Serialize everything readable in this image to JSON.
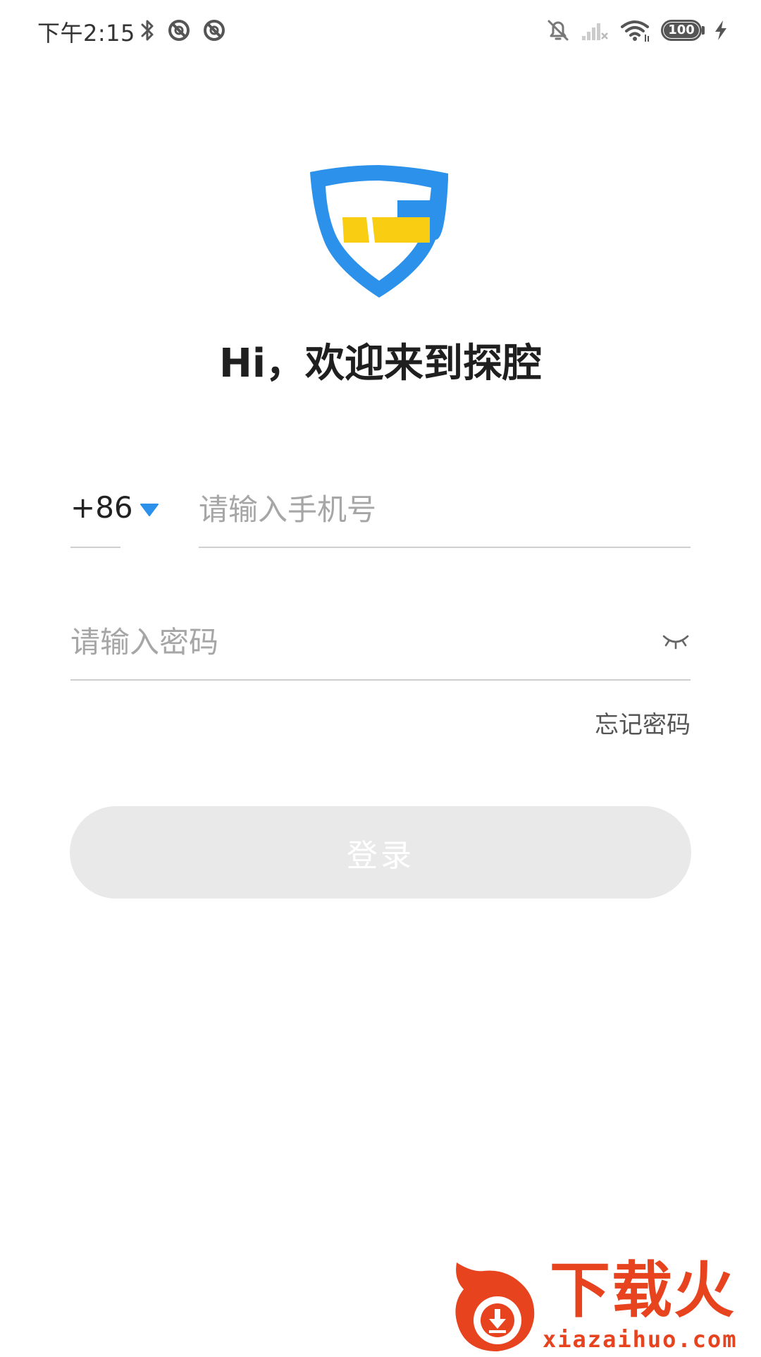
{
  "status_bar": {
    "time": "下午2:15",
    "battery_level": "100",
    "icons": [
      "bluetooth-icon",
      "sync-icon",
      "sync-icon",
      "mute-icon",
      "no-signal-icon",
      "wifi-icon",
      "battery-icon",
      "charging-icon"
    ]
  },
  "app": {
    "logo": "shield-logo-icon",
    "welcome_title": "Hi，欢迎来到探腔",
    "brand_colors": {
      "blue": "#2c91ea",
      "yellow": "#f8cd12"
    }
  },
  "login_form": {
    "country_code": "+86",
    "phone_placeholder": "请输入手机号",
    "phone_value": "",
    "password_placeholder": "请输入密码",
    "password_value": "",
    "password_visibility_icon": "eye-closed-icon",
    "forgot_password": "忘记密码",
    "login_button": "登录",
    "accent_color": "#2c91ea",
    "login_button_color": "#e9e9e9"
  },
  "watermark": {
    "name": "下载火",
    "url": "xiazaihuo.com",
    "color": "#e8431f"
  }
}
